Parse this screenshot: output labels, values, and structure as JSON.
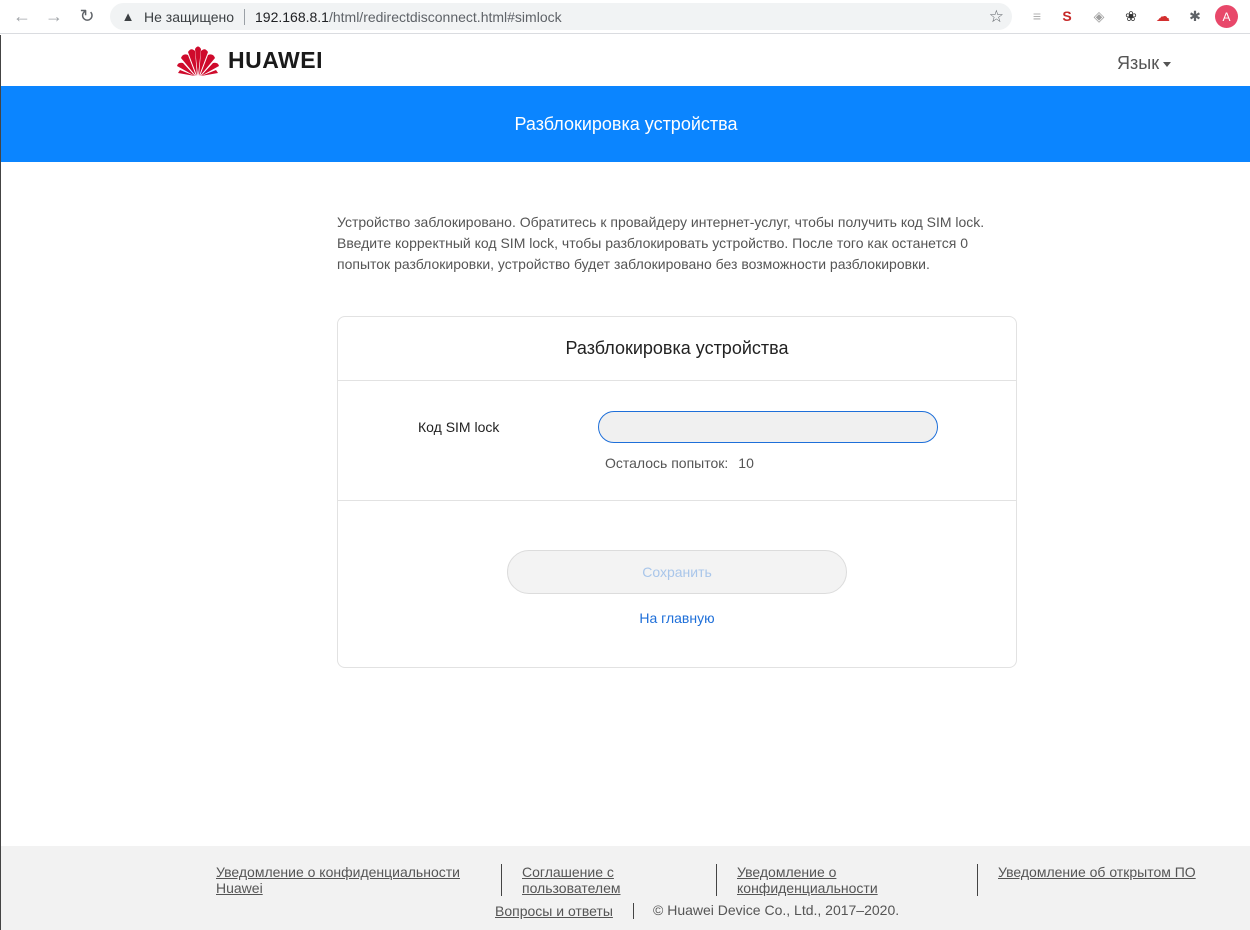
{
  "browser": {
    "insecure_label": "Не защищено",
    "url_host": "192.168.8.1",
    "url_path": "/html/redirectdisconnect.html#simlock",
    "profile_initial": "A"
  },
  "header": {
    "brand": "HUAWEI",
    "language_label": "Язык"
  },
  "banner": {
    "title": "Разблокировка устройства"
  },
  "description": {
    "text": "Устройство заблокировано. Обратитесь к провайдеру интернет-услуг, чтобы получить код SIM lock. Введите корректный код SIM lock, чтобы разблокировать устройство. После того как останется 0 попыток разблокировки, устройство будет заблокировано без возможности разблокировки."
  },
  "card": {
    "title": "Разблокировка устройства",
    "sim_label": "Код SIM lock",
    "sim_value": "",
    "attempts_label": "Осталось попыток:",
    "attempts_value": "10",
    "save_label": "Сохранить",
    "home_label": "На главную"
  },
  "footer": {
    "privacy_huawei": "Уведомление о конфиденциальности Huawei",
    "user_agreement": "Соглашение с пользователем",
    "privacy_notice": "Уведомление о конфиденциальности",
    "open_source": "Уведомление об открытом ПО",
    "faq": "Вопросы и ответы",
    "copyright": "© Huawei Device Co., Ltd., 2017–2020."
  },
  "colors": {
    "banner": "#0b85ff",
    "link": "#1e6fd9",
    "brand_red": "#cf0a2c"
  }
}
